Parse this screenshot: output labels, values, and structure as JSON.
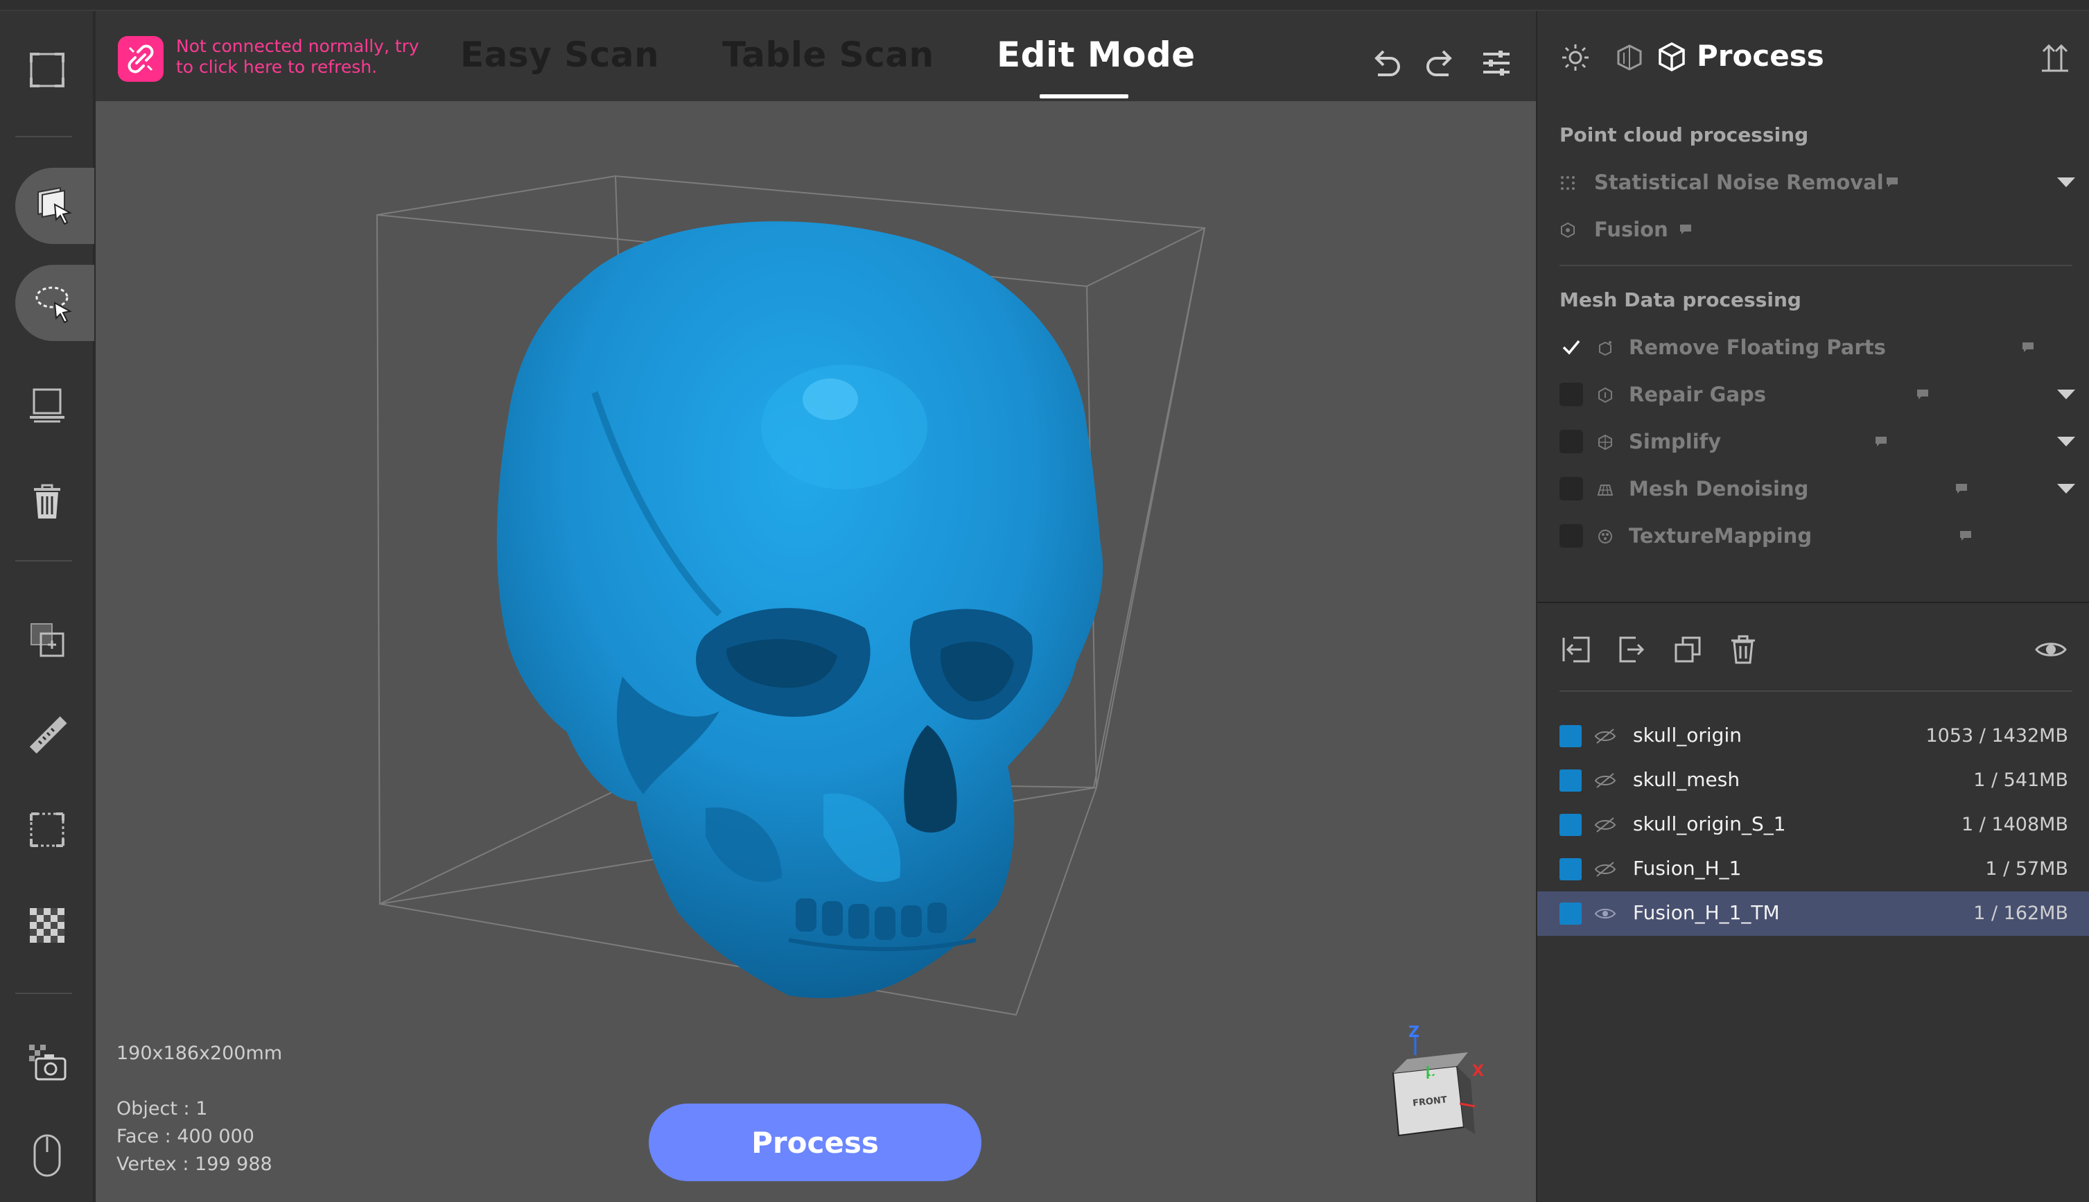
{
  "header": {
    "connection_warning": "Not connected normally, try to click here to refresh.",
    "tabs": [
      {
        "label": "Easy Scan"
      },
      {
        "label": "Table Scan"
      },
      {
        "label": "Edit Mode"
      }
    ],
    "active_tab": "Edit Mode"
  },
  "viewport": {
    "dimensions": "190x186x200mm",
    "object_count": "Object : 1",
    "face_count": "Face : 400 000",
    "vertex_count": "Vertex : 199 988",
    "process_button": "Process",
    "model_color": "#1a8fd1",
    "view_cube": {
      "front": "FRONT",
      "z": "Z",
      "x": "X",
      "y": "Y"
    }
  },
  "right_panel": {
    "title": "Process",
    "point_cloud": {
      "title": "Point cloud processing",
      "items": [
        {
          "label": "Statistical Noise Removal",
          "icon": "noise-icon",
          "has_dropdown": true
        },
        {
          "label": "Fusion",
          "icon": "fusion-icon",
          "has_dropdown": false
        }
      ]
    },
    "mesh": {
      "title": "Mesh Data processing",
      "items": [
        {
          "label": "Remove Floating Parts",
          "checked": true,
          "has_dropdown": false
        },
        {
          "label": "Repair Gaps",
          "checked": false,
          "has_dropdown": true
        },
        {
          "label": "Simplify",
          "checked": false,
          "has_dropdown": true
        },
        {
          "label": "Mesh Denoising",
          "checked": false,
          "has_dropdown": true
        },
        {
          "label": "TextureMapping",
          "checked": false,
          "has_dropdown": false
        }
      ]
    },
    "layers": [
      {
        "name": "skull_origin",
        "size": "1053 / 1432MB",
        "visible": false,
        "selected": false
      },
      {
        "name": "skull_mesh",
        "size": "1 / 541MB",
        "visible": false,
        "selected": false
      },
      {
        "name": "skull_origin_S_1",
        "size": "1 / 1408MB",
        "visible": false,
        "selected": false
      },
      {
        "name": "Fusion_H_1",
        "size": "1 / 57MB",
        "visible": false,
        "selected": false
      },
      {
        "name": "Fusion_H_1_TM",
        "size": "1 / 162MB",
        "visible": true,
        "selected": true
      }
    ]
  }
}
